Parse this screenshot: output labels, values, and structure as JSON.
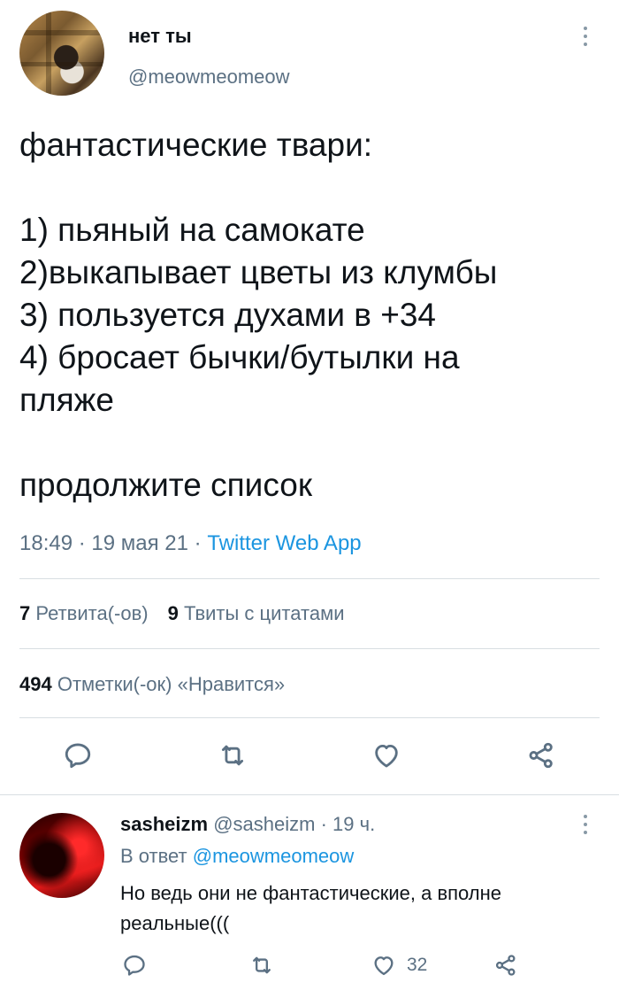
{
  "tweet": {
    "display_name": "нет ты",
    "handle": "@meowmeomeow",
    "body_lines": [
      "фантастические твари:",
      "",
      "1) пьяный на самокате",
      "2)выкапывает цветы из клумбы",
      "3) пользуется духами в +34",
      "4) бросает бычки/бутылки на",
      "пляже",
      "",
      "продолжите список"
    ],
    "time": "18:49",
    "date": "19 мая 21",
    "separator": "·",
    "source": "Twitter Web App",
    "retweets_count": "7",
    "retweets_label": "Ретвита(-ов)",
    "quotes_count": "9",
    "quotes_label": "Твиты с цитатами",
    "likes_count": "494",
    "likes_label": "Отметки(-ок) «Нравится»",
    "actions": [
      "reply-icon",
      "retweet-icon",
      "heart-icon",
      "share-icon"
    ]
  },
  "reply": {
    "display_name": "sasheizm",
    "handle": "@sasheizm",
    "separator": "·",
    "time_ago": "19 ч.",
    "reply_to_label": "В ответ",
    "reply_to_handle": "@meowmeomeow",
    "text": "Но ведь они не фантастические, а вполне реальные(((",
    "like_count": "32"
  },
  "colors": {
    "text": "#0f1419",
    "secondary": "#5b7083",
    "link": "#1b95e0",
    "divider": "#d8dee2"
  }
}
